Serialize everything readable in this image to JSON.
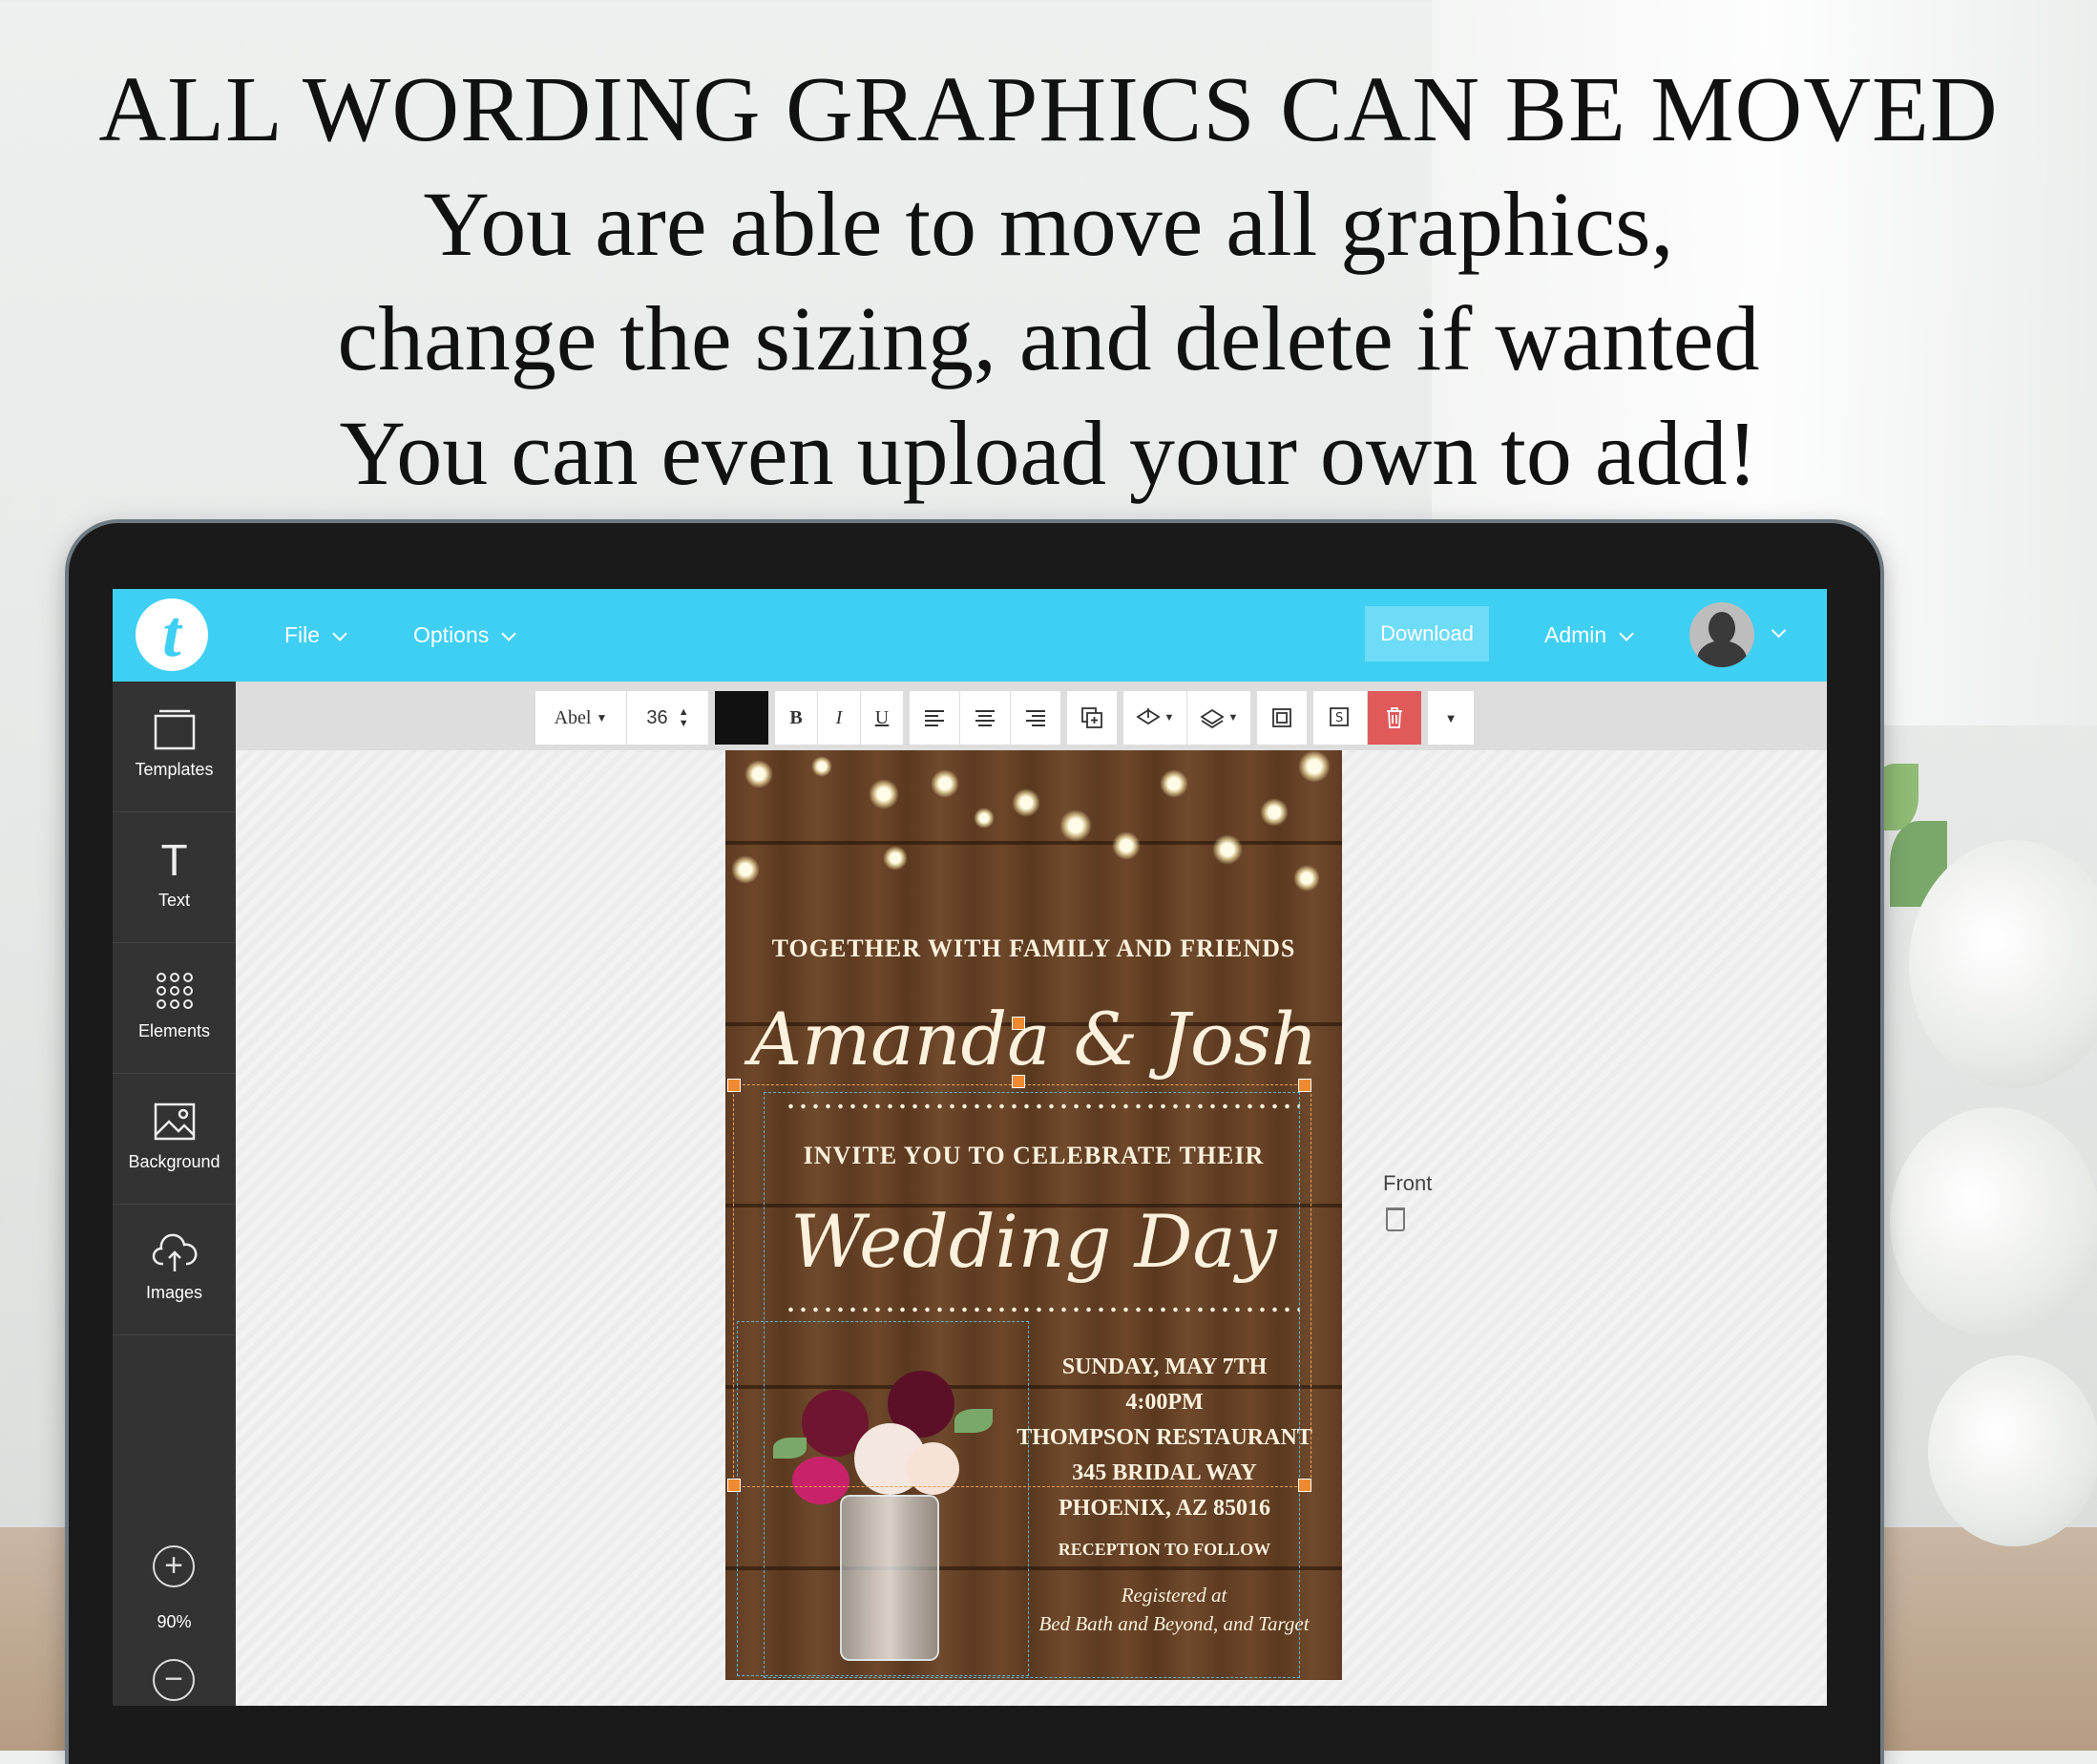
{
  "headline": {
    "line1": "ALL WORDING GRAPHICS CAN BE MOVED",
    "line2": "You are able to move all graphics,",
    "line3": "change the sizing, and delete if wanted",
    "line4": "You can even upload your own to add!"
  },
  "topbar": {
    "logo_letter": "t",
    "file_label": "File",
    "options_label": "Options",
    "download_label": "Download",
    "admin_label": "Admin",
    "accent_color": "#3ecff3"
  },
  "sidebar": {
    "items": [
      {
        "label": "Templates",
        "icon": "templates-icon"
      },
      {
        "label": "Text",
        "icon": "text-icon"
      },
      {
        "label": "Elements",
        "icon": "elements-icon"
      },
      {
        "label": "Background",
        "icon": "background-icon"
      },
      {
        "label": "Images",
        "icon": "upload-cloud-icon"
      }
    ],
    "zoom": "90%"
  },
  "toolbar": {
    "font": "Abel",
    "size": "36",
    "bold": "B",
    "italic": "I",
    "underline": "U",
    "text_color": "#111111",
    "delete_color": "#e05a5a"
  },
  "card": {
    "line_top": "TOGETHER WITH FAMILY AND FRIENDS",
    "names": "Amanda & Josh",
    "invite": "INVITE YOU TO CELEBRATE THEIR",
    "event": "Wedding Day",
    "details": [
      "SUNDAY, MAY 7TH",
      "4:00PM",
      "THOMPSON RESTAURANT",
      "345 BRIDAL WAY",
      "PHOENIX, AZ 85016"
    ],
    "reception": "RECEPTION TO FOLLOW",
    "registered": "Registered at",
    "stores": "Bed Bath and Beyond, and Target"
  },
  "pages": {
    "current": "Front"
  }
}
